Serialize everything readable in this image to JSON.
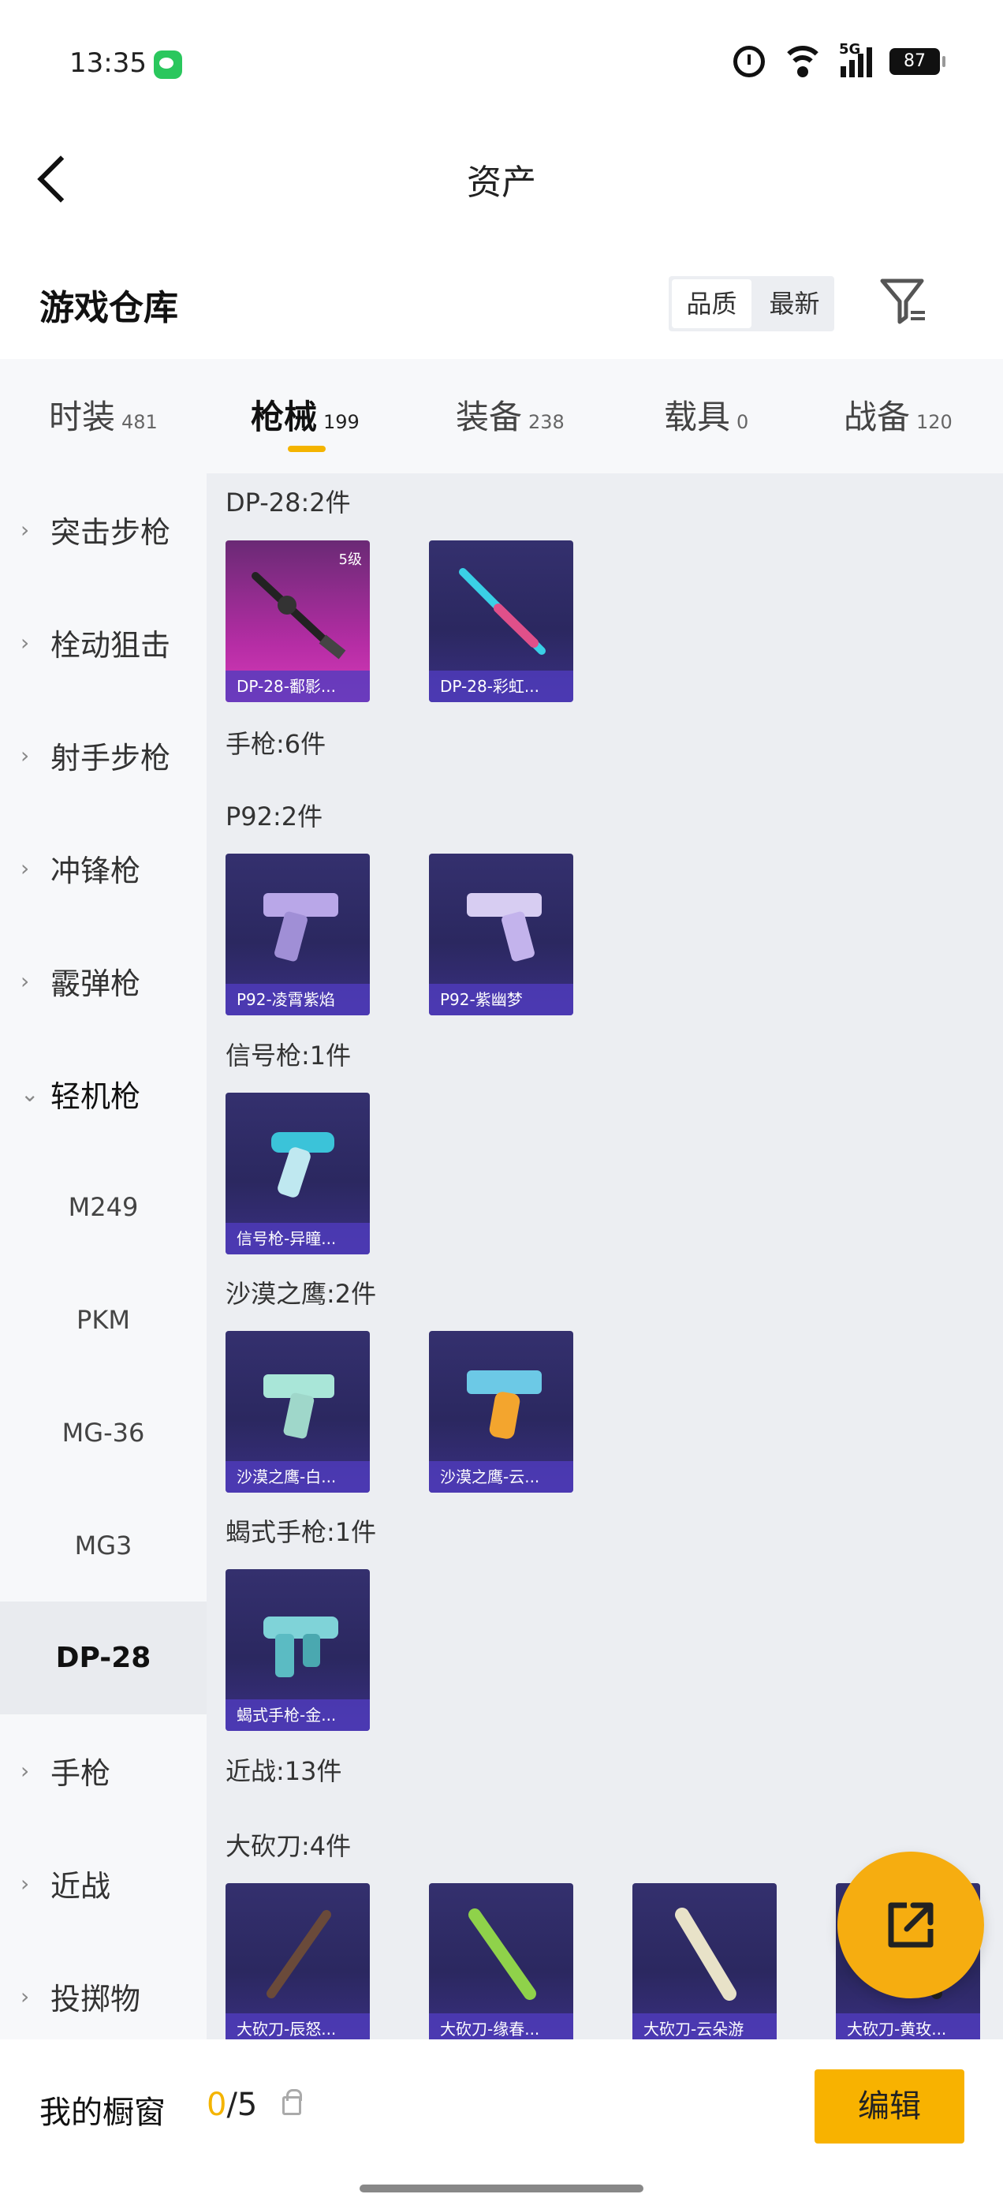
{
  "status_bar": {
    "time": "13:35",
    "network": "5G",
    "battery": "87"
  },
  "nav": {
    "title": "资产"
  },
  "header": {
    "title": "游戏仓库",
    "sort_options": [
      "品质",
      "最新"
    ],
    "active_sort": "品质"
  },
  "tabs": [
    {
      "label": "时装",
      "count": "481"
    },
    {
      "label": "枪械",
      "count": "199"
    },
    {
      "label": "装备",
      "count": "238"
    },
    {
      "label": "载具",
      "count": "0"
    },
    {
      "label": "战备",
      "count": "120"
    }
  ],
  "active_tab": "枪械",
  "sidebar": {
    "items": [
      {
        "label": "突击步枪"
      },
      {
        "label": "栓动狙击"
      },
      {
        "label": "射手步枪"
      },
      {
        "label": "冲锋枪"
      },
      {
        "label": "霰弹枪"
      },
      {
        "label": "轻机枪"
      },
      {
        "label": "M249"
      },
      {
        "label": "PKM"
      },
      {
        "label": "MG-36"
      },
      {
        "label": "MG3"
      },
      {
        "label": "DP-28"
      },
      {
        "label": "手枪"
      },
      {
        "label": "近战"
      },
      {
        "label": "投掷物"
      }
    ]
  },
  "groups": {
    "dp28": "DP-28:2件",
    "pistol": "手枪:6件",
    "p92": "P92:2件",
    "flare": "信号枪:1件",
    "deagle": "沙漠之鹰:2件",
    "scorpion": "蝎式手枪:1件",
    "melee": "近战:13件",
    "machete": "大砍刀:4件"
  },
  "cards": {
    "dp28_1": {
      "caption": "DP-28-鄱影...",
      "level": "5级"
    },
    "dp28_2": {
      "caption": "DP-28-彩虹..."
    },
    "p92_1": {
      "caption": "P92-凌霄紫焰"
    },
    "p92_2": {
      "caption": "P92-紫幽梦"
    },
    "flare_1": {
      "caption": "信号枪-异瞳..."
    },
    "deagle_1": {
      "caption": "沙漠之鹰-白..."
    },
    "deagle_2": {
      "caption": "沙漠之鹰-云..."
    },
    "scorpion_1": {
      "caption": "蝎式手枪-金..."
    },
    "machete_1": {
      "caption": "大砍刀-辰怒..."
    },
    "machete_2": {
      "caption": "大砍刀-缘春..."
    },
    "machete_3": {
      "caption": "大砍刀-云朵游"
    },
    "machete_4": {
      "caption": "大砍刀-黄玫..."
    }
  },
  "bottom": {
    "cabinet_label": "我的橱窗",
    "used": "0",
    "capacity": "/5",
    "edit_label": "编辑"
  },
  "colors": {
    "accent": "#f4b400",
    "button": "#f8b200",
    "card_bg": "#2b2860"
  }
}
